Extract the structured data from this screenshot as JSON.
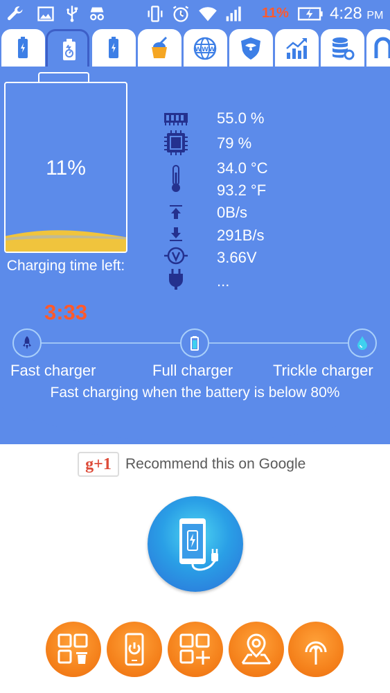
{
  "status_bar": {
    "battery_percent": "11%",
    "time": "4:28",
    "ampm": "PM",
    "left_icons": [
      "wrench-icon",
      "image-icon",
      "usb-icon",
      "incognito-icon"
    ],
    "right_icons": [
      "vibrate-icon",
      "alarm-icon",
      "wifi-icon",
      "signal-icon",
      "battery-charging-icon"
    ]
  },
  "tabs": [
    {
      "icon": "battery-icon",
      "active": false
    },
    {
      "icon": "battery-gauge-icon",
      "active": true
    },
    {
      "icon": "battery-charge-icon",
      "active": false
    },
    {
      "icon": "cleaner-icon",
      "active": false
    },
    {
      "icon": "www-icon",
      "active": false
    },
    {
      "icon": "shield-icon",
      "active": false
    },
    {
      "icon": "chart-icon",
      "active": false
    },
    {
      "icon": "database-settings-icon",
      "active": false
    },
    {
      "icon": "magnet-icon",
      "active": false
    }
  ],
  "battery": {
    "level_text": "11%",
    "level": 0.11,
    "charging_time_label": "Charging time left:",
    "charging_time": "3:33"
  },
  "stats": [
    {
      "icon": "ram-icon",
      "value": "55.0 %"
    },
    {
      "icon": "cpu-icon",
      "value": "79 %"
    },
    {
      "icon": "thermometer-icon",
      "value": "34.0 °C"
    },
    {
      "icon": "",
      "value": "93.2 °F"
    },
    {
      "icon": "upload-icon",
      "value": "0B/s"
    },
    {
      "icon": "download-icon",
      "value": "291B/s"
    },
    {
      "icon": "voltage-icon",
      "value": "3.66V"
    },
    {
      "icon": "plug-icon",
      "value": "..."
    }
  ],
  "charger": {
    "modes": [
      "Fast charger",
      "Full charger",
      "Trickle charger"
    ],
    "note": "Fast charging when the battery is below 80%"
  },
  "google": {
    "button_label": "g+1",
    "recommend_text": "Recommend this on Google"
  },
  "colors": {
    "primary": "#5c8bea",
    "accent_orange": "#f5821c",
    "warning_red": "#ff5a2c",
    "battery_fill": "#f0c43d"
  }
}
